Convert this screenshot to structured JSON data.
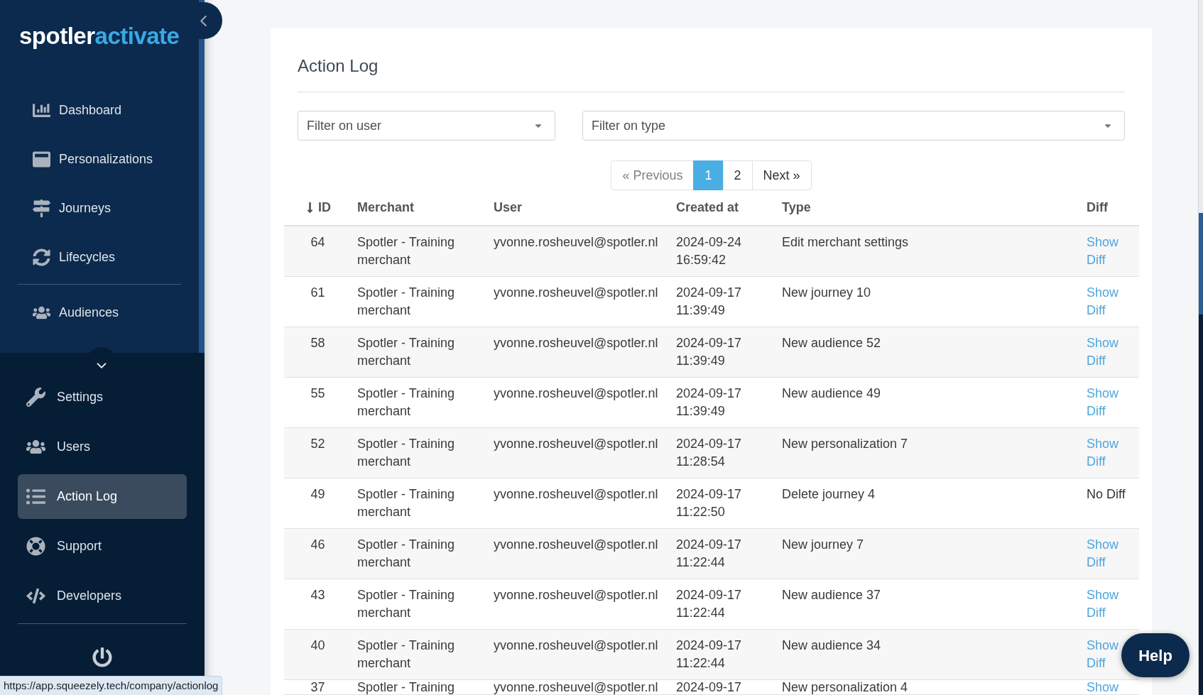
{
  "sidebar": {
    "logo": {
      "text": "spotler",
      "accent_text": "activate"
    },
    "top_sections": [
      {
        "items": [
          {
            "label": "Dashboard",
            "selected": false
          },
          {
            "label": "Personalizations",
            "selected": false
          },
          {
            "label": "Journeys",
            "selected": false
          },
          {
            "label": "Lifecycles",
            "selected": false
          }
        ]
      },
      {
        "items": [
          {
            "label": "Audiences",
            "selected": false
          }
        ]
      }
    ],
    "bottom_items": [
      {
        "label": "Settings",
        "selected": false
      },
      {
        "label": "Users",
        "selected": false
      },
      {
        "label": "Action Log",
        "selected": true
      },
      {
        "label": "Support",
        "selected": false
      },
      {
        "label": "Developers",
        "selected": false
      }
    ]
  },
  "main": {
    "title": "Action Log",
    "filters": [
      {
        "placeholder": "Filter on user"
      },
      {
        "placeholder": "Filter on type"
      }
    ],
    "pagination": {
      "previous": {
        "label": "« Previous",
        "disabled": true
      },
      "pages": [
        {
          "label": "1",
          "selected": true
        },
        {
          "label": "2",
          "selected": false
        }
      ],
      "next": {
        "label": "Next »",
        "disabled": false
      }
    },
    "table": {
      "columns": [
        {
          "label": "ID",
          "sort_descending": true
        },
        {
          "label": "Merchant"
        },
        {
          "label": "User"
        },
        {
          "label": "Created at"
        },
        {
          "label": "Type"
        },
        {
          "label": "Diff"
        }
      ],
      "rows": [
        {
          "id": "64",
          "merchant": "Spotler - Training merchant",
          "user": "yvonne.rosheuvel@spotler.nl",
          "created_at": "2024-09-24 16:59:42",
          "type": "Edit merchant settings",
          "diff": {
            "kind": "link",
            "label": "Show Diff"
          }
        },
        {
          "id": "61",
          "merchant": "Spotler - Training merchant",
          "user": "yvonne.rosheuvel@spotler.nl",
          "created_at": "2024-09-17 11:39:49",
          "type": "New journey 10",
          "diff": {
            "kind": "link",
            "label": "Show Diff"
          }
        },
        {
          "id": "58",
          "merchant": "Spotler - Training merchant",
          "user": "yvonne.rosheuvel@spotler.nl",
          "created_at": "2024-09-17 11:39:49",
          "type": "New audience 52",
          "diff": {
            "kind": "link",
            "label": "Show Diff"
          }
        },
        {
          "id": "55",
          "merchant": "Spotler - Training merchant",
          "user": "yvonne.rosheuvel@spotler.nl",
          "created_at": "2024-09-17 11:39:49",
          "type": "New audience 49",
          "diff": {
            "kind": "link",
            "label": "Show Diff"
          }
        },
        {
          "id": "52",
          "merchant": "Spotler - Training merchant",
          "user": "yvonne.rosheuvel@spotler.nl",
          "created_at": "2024-09-17 11:28:54",
          "type": "New personalization 7",
          "diff": {
            "kind": "link",
            "label": "Show Diff"
          }
        },
        {
          "id": "49",
          "merchant": "Spotler - Training merchant",
          "user": "yvonne.rosheuvel@spotler.nl",
          "created_at": "2024-09-17 11:22:50",
          "type": "Delete journey 4",
          "diff": {
            "kind": "text",
            "label": "No Diff"
          }
        },
        {
          "id": "46",
          "merchant": "Spotler - Training merchant",
          "user": "yvonne.rosheuvel@spotler.nl",
          "created_at": "2024-09-17 11:22:44",
          "type": "New journey 7",
          "diff": {
            "kind": "link",
            "label": "Show Diff"
          }
        },
        {
          "id": "43",
          "merchant": "Spotler - Training merchant",
          "user": "yvonne.rosheuvel@spotler.nl",
          "created_at": "2024-09-17 11:22:44",
          "type": "New audience 37",
          "diff": {
            "kind": "link",
            "label": "Show Diff"
          }
        },
        {
          "id": "40",
          "merchant": "Spotler - Training merchant",
          "user": "yvonne.rosheuvel@spotler.nl",
          "created_at": "2024-09-17 11:22:44",
          "type": "New audience 34",
          "diff": {
            "kind": "link",
            "label": "Show Diff"
          }
        },
        {
          "id": "37",
          "merchant": "Spotler - Training",
          "user": "yvonne.rosheuvel@spotler.nl",
          "created_at": "2024-09-17",
          "type": "New personalization 4",
          "diff": {
            "kind": "link",
            "label": "Show"
          }
        }
      ]
    }
  },
  "help_button": {
    "label": "Help"
  },
  "status_url": "https://app.squeezely.tech/company/actionlog"
}
